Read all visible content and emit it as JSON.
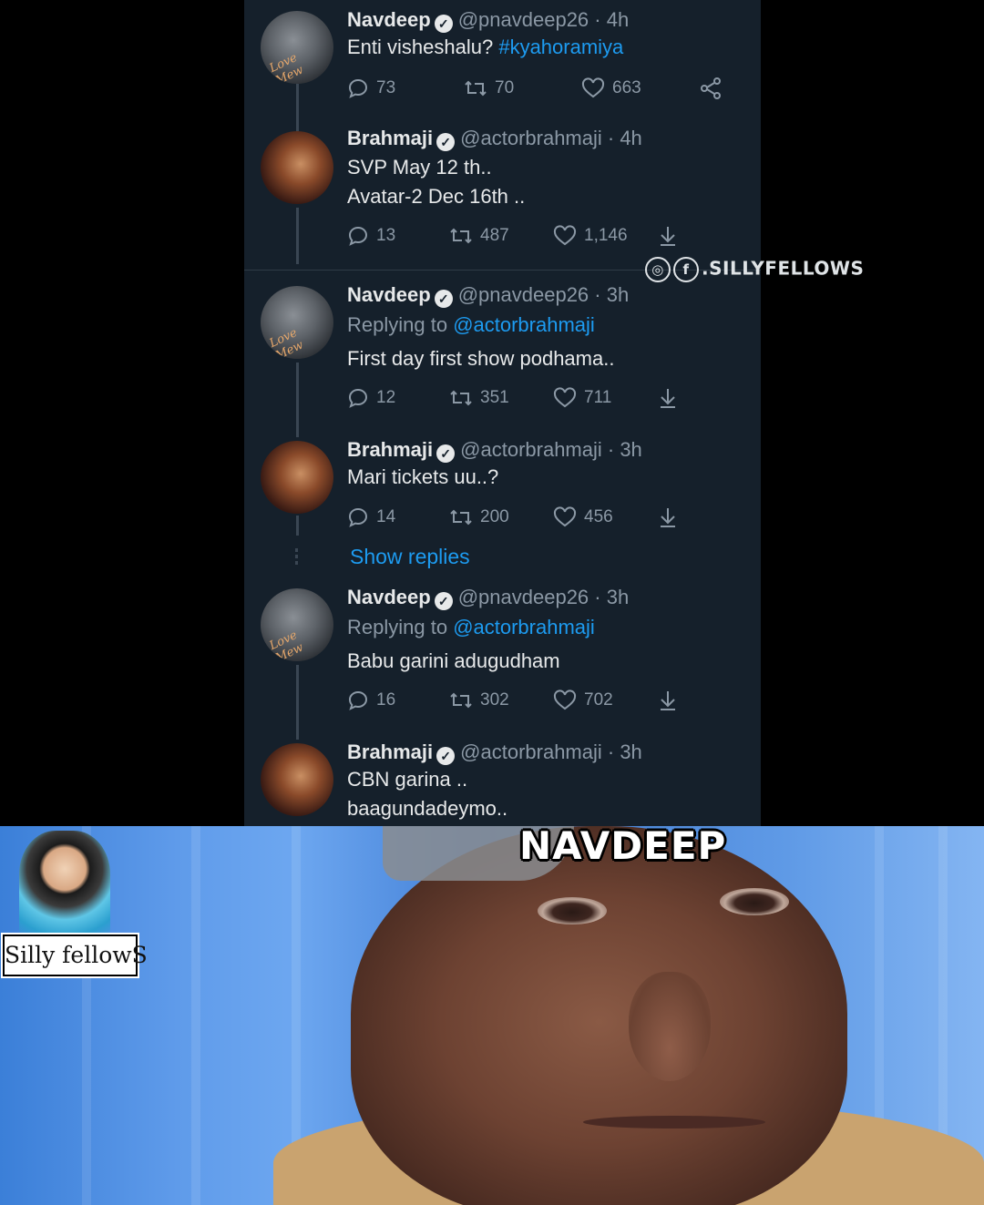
{
  "tweets": [
    {
      "name": "Navdeep",
      "handle": "@pnavdeep26 · 4h",
      "reply_to_prefix": "",
      "reply_to": "",
      "lines": [
        "Enti visheshalu? "
      ],
      "hashtag": "#kyahoramiya",
      "replies": "73",
      "retweets": "70",
      "likes": "663",
      "share_icon": "share-icon"
    },
    {
      "name": "Brahmaji",
      "handle": "@actorbrahmaji · 4h",
      "lines": [
        "SVP May 12 th..",
        "Avatar-2 Dec 16th .."
      ],
      "replies": "13",
      "retweets": "487",
      "likes": "1,146",
      "share_icon": "download-icon"
    },
    {
      "name": "Navdeep",
      "handle": "@pnavdeep26 · 3h",
      "reply_to_prefix": "Replying to ",
      "reply_to": "@actorbrahmaji",
      "lines": [
        "First day first show podhama.."
      ],
      "replies": "12",
      "retweets": "351",
      "likes": "711",
      "share_icon": "download-icon"
    },
    {
      "name": "Brahmaji",
      "handle": "@actorbrahmaji · 3h",
      "lines": [
        "Mari tickets uu..?"
      ],
      "replies": "14",
      "retweets": "200",
      "likes": "456",
      "share_icon": "download-icon"
    },
    {
      "name": "Navdeep",
      "handle": "@pnavdeep26 · 3h",
      "reply_to_prefix": "Replying to ",
      "reply_to": "@actorbrahmaji",
      "lines": [
        "Babu garini adugudham"
      ],
      "replies": "16",
      "retweets": "302",
      "likes": "702",
      "share_icon": "download-icon"
    },
    {
      "name": "Brahmaji",
      "handle": "@actorbrahmaji · 3h",
      "lines": [
        "CBN garina ..",
        "baagundadeymo.."
      ]
    }
  ],
  "show_replies": "Show replies",
  "avatar_signature": "Love Mew",
  "watermark": ".SILLYFELLOWS",
  "meme_caption": "NAVDEEP",
  "logo_text": "Silly fellowS",
  "colors": {
    "background": "#15202b",
    "link": "#1d9bf0",
    "text": "#e7e9ea",
    "muted": "#8b98a5"
  }
}
